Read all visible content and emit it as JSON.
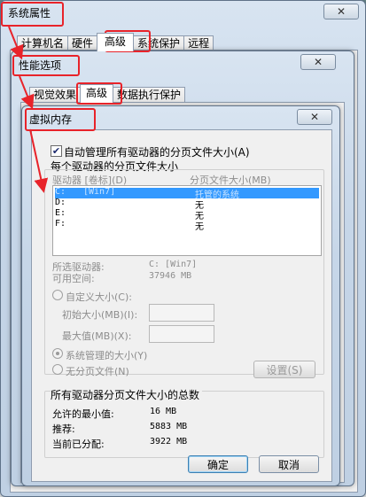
{
  "sys": {
    "title": "系统属性",
    "tabs": [
      "计算机名",
      "硬件",
      "高级",
      "系统保护",
      "远程"
    ],
    "close": "✕"
  },
  "perf": {
    "title": "性能选项",
    "tabs": [
      "视觉效果",
      "高级",
      "数据执行保护"
    ],
    "close": "✕"
  },
  "vm": {
    "title": "虚拟内存",
    "close": "✕",
    "auto_manage_label": "自动管理所有驱动器的分页文件大小(A)",
    "auto_manage_checked": true,
    "section_each_drive": "每个驱动器的分页文件大小",
    "col_drive": "驱动器 [卷标](D)",
    "col_paging": "分页文件大小(MB)",
    "drives": [
      {
        "drive": "C:",
        "label": "[Win7]",
        "size": "托管的系统",
        "selected": true
      },
      {
        "drive": "D:",
        "label": "",
        "size": "无",
        "selected": false
      },
      {
        "drive": "E:",
        "label": "",
        "size": "无",
        "selected": false
      },
      {
        "drive": "F:",
        "label": "",
        "size": "无",
        "selected": false
      }
    ],
    "selected_drive_label": "所选驱动器:",
    "selected_drive_value": "C: [Win7]",
    "free_space_label": "可用空间:",
    "free_space_value": "37946 MB",
    "custom_size_label": "自定义大小(C):",
    "initial_size_label": "初始大小(MB)(I):",
    "max_size_label": "最大值(MB)(X):",
    "system_managed_label": "系统管理的大小(Y)",
    "no_paging_label": "无分页文件(N)",
    "set_button": "设置(S)",
    "totals_title": "所有驱动器分页文件大小的总数",
    "min_allowed_label": "允许的最小值:",
    "min_allowed_value": "16 MB",
    "recommended_label": "推荐:",
    "recommended_value": "5883 MB",
    "allocated_label": "当前已分配:",
    "allocated_value": "3922 MB",
    "ok_button": "确定",
    "cancel_button": "取消"
  },
  "colors": {
    "highlight": "#e8232a",
    "selection": "#3399ff"
  }
}
